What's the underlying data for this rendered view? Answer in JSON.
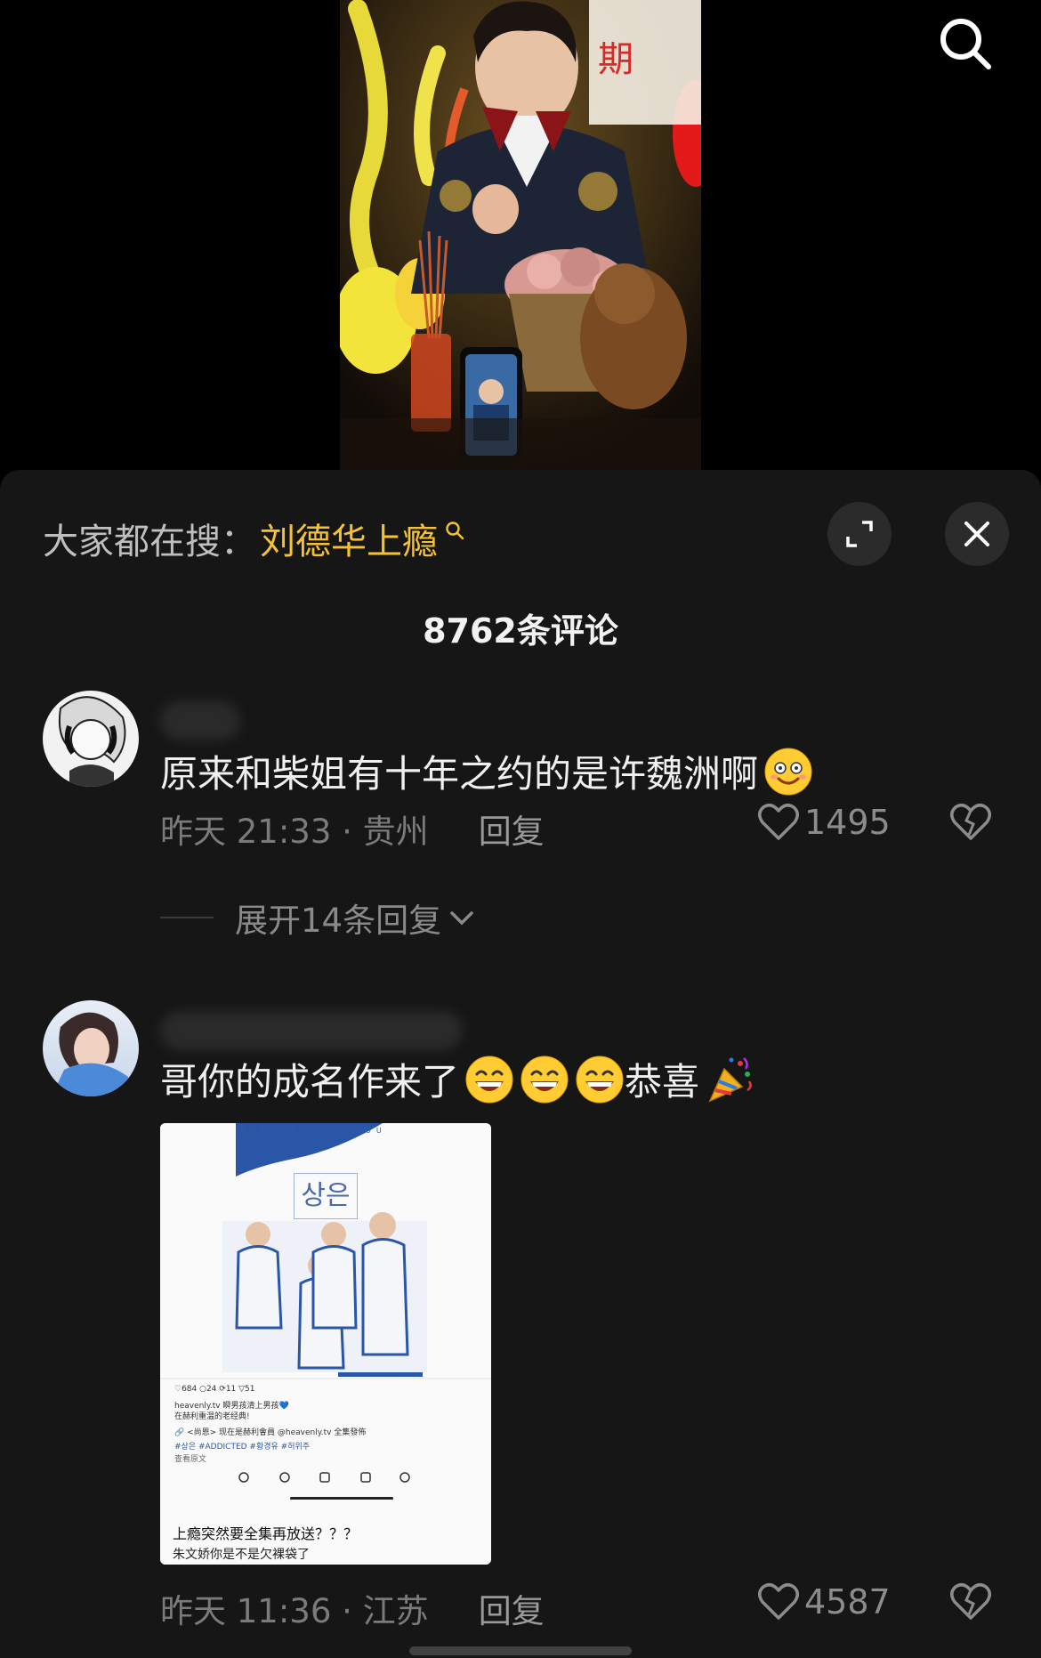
{
  "header": {
    "search_icon": "search-icon"
  },
  "sheet": {
    "search_prefix": "大家都在搜：",
    "search_hot": "刘德华上瘾",
    "expand_icon": "expand-icon",
    "close_icon": "close-icon",
    "count_title": "8762条评论"
  },
  "comments": [
    {
      "text": "原来和柴姐有十年之约的是许魏洲啊",
      "emoji": "smiling-face-emoji",
      "time_location": "昨天 21:33 · 贵州",
      "reply_label": "回复",
      "likes": "1495",
      "expand_label": "展开14条回复"
    },
    {
      "text": "哥你的成名作来了",
      "emoji_after": "恭喜",
      "time_location": "昨天 11:36 · 江苏",
      "reply_label": "回复",
      "likes": "4587",
      "attachment": {
        "poster_top": "ADDICTED TO YOU",
        "poster_title": "상은",
        "likes_line": "♡684  ○24  ⟳11  ▽51",
        "post_line1": "heavenly.tv 瞬男孩清上男孩💙",
        "post_line2": "在赫利重温的老经典!",
        "post_line3": "🔗 <尚恩> 现在是赫利會員 @heavenly.tv 全集發佈",
        "post_line4": "#상은 #ADDICTED #황경유 #허위주",
        "post_line5": "查看原文",
        "caption1": "上瘾突然要全集再放送？？？",
        "caption2": "朱文娇你是不是欠裸袋了"
      }
    }
  ],
  "colors": {
    "background": "#000000",
    "sheet": "#161616",
    "hot_search": "#f5c234",
    "meta_text": "#7b7b7b"
  }
}
